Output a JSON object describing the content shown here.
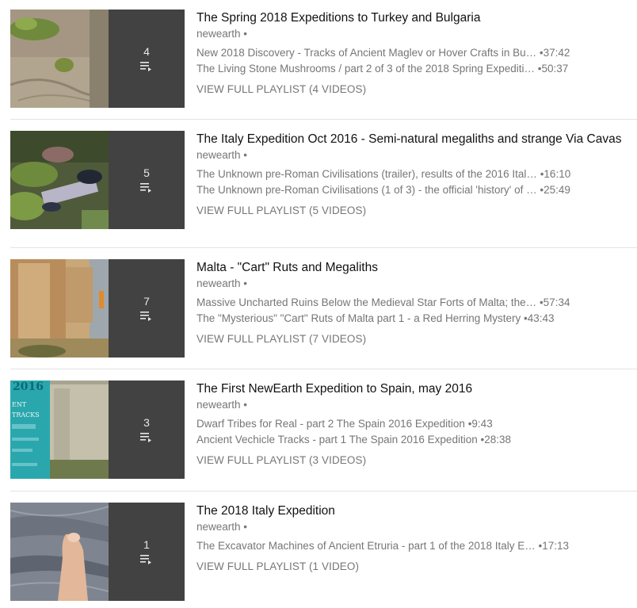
{
  "playlists": [
    {
      "title": "The Spring 2018 Expeditions to Turkey and Bulgaria",
      "channel": "newearth",
      "count": "4",
      "videos": [
        {
          "title": "New 2018 Discovery - Tracks of Ancient Maglev or Hover Crafts in Bu…",
          "duration": "37:42"
        },
        {
          "title": "The Living Stone Mushrooms / part 2 of 3 of the 2018 Spring Expediti…",
          "duration": "50:37"
        }
      ],
      "view_full": "VIEW FULL PLAYLIST (4 VIDEOS)"
    },
    {
      "title": "The Italy Expedition Oct 2016 - Semi-natural megaliths and strange Via Cavas",
      "channel": "newearth",
      "count": "5",
      "videos": [
        {
          "title": "The Unknown pre-Roman Civilisations (trailer), results of the 2016 Ital…",
          "duration": "16:10"
        },
        {
          "title": "The Unknown pre-Roman Civilisations (1 of 3) - the official 'history' of …",
          "duration": "25:49"
        }
      ],
      "view_full": "VIEW FULL PLAYLIST (5 VIDEOS)"
    },
    {
      "title": "Malta - \"Cart\" Ruts and Megaliths",
      "channel": "newearth",
      "count": "7",
      "videos": [
        {
          "title": "Massive Uncharted Ruins Below the Medieval Star Forts of Malta; the…",
          "duration": "57:34"
        },
        {
          "title": "The \"Mysterious\" \"Cart\" Ruts of Malta part 1 - a Red Herring Mystery",
          "duration": "43:43"
        }
      ],
      "view_full": "VIEW FULL PLAYLIST (7 VIDEOS)"
    },
    {
      "title": "The First NewEarth Expedition to Spain, may 2016",
      "channel": "newearth",
      "count": "3",
      "videos": [
        {
          "title": "Dwarf Tribes for Real - part 2 The Spain 2016 Expedition",
          "duration": "9:43"
        },
        {
          "title": "Ancient Vechicle Tracks - part 1 The Spain 2016 Expedition",
          "duration": "28:38"
        }
      ],
      "view_full": "VIEW FULL PLAYLIST (3 VIDEOS)"
    },
    {
      "title": "The 2018 Italy Expedition",
      "channel": "newearth",
      "count": "1",
      "videos": [
        {
          "title": "The Excavator Machines of Ancient Etruria - part 1 of the 2018 Italy E…",
          "duration": "17:13"
        }
      ],
      "view_full": "VIEW FULL PLAYLIST (1 VIDEO)"
    }
  ],
  "thumbnail_text": {
    "year": "2016",
    "ent": "ENT",
    "tracks": "TRACKS"
  },
  "colors": {
    "title": "#111111",
    "meta": "#767676",
    "overlay": "#282828",
    "divider": "#e3e3e3"
  },
  "icons": {
    "playlist": "playlist-play-icon",
    "separator": "bullet-separator"
  }
}
